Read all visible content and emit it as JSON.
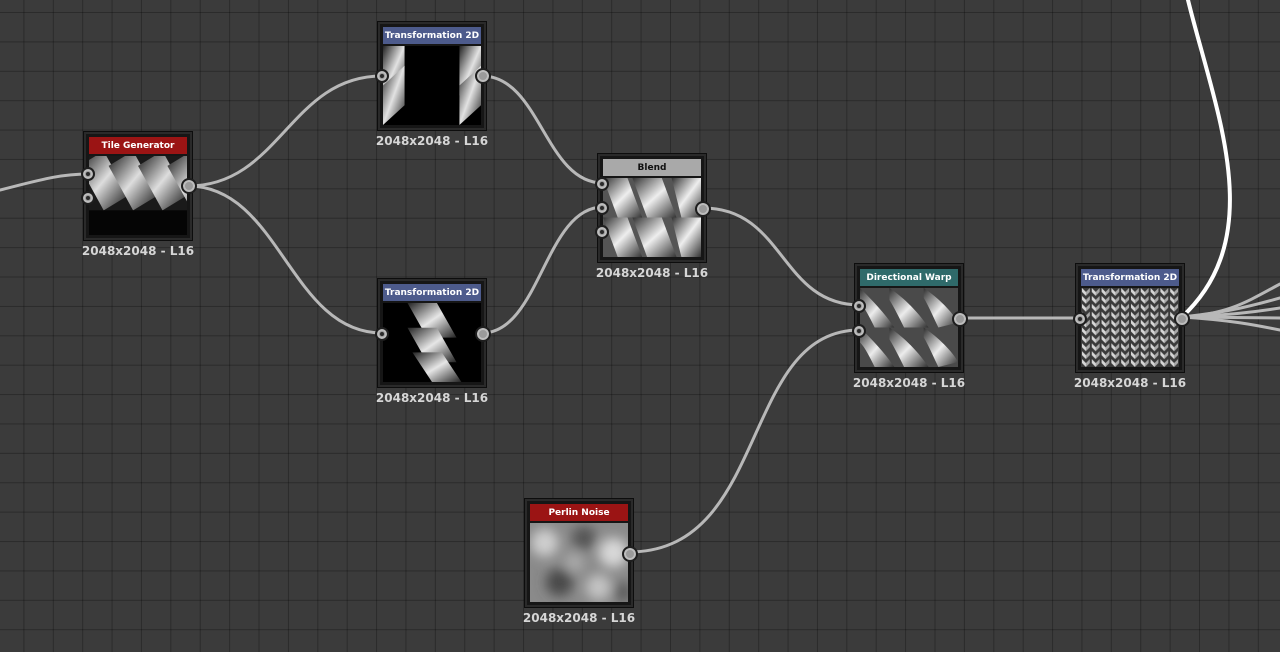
{
  "colors": {
    "canvas": "#3b3b3b",
    "wire": "#b8b8b8",
    "wire_highlight": "#ffffff",
    "header_generator": "#9b1414",
    "header_transform": "#4d5b8c",
    "header_blend": "#a9a9a9",
    "header_warp": "#2f6a6a"
  },
  "nodes": {
    "tile_generator": {
      "title": "Tile Generator",
      "resolution": "2048x2048 - L16"
    },
    "transform_top": {
      "title": "Transformation 2D",
      "resolution": "2048x2048 - L16"
    },
    "transform_bottom": {
      "title": "Transformation 2D",
      "resolution": "2048x2048 - L16"
    },
    "blend": {
      "title": "Blend",
      "resolution": "2048x2048 - L16"
    },
    "perlin_noise": {
      "title": "Perlin Noise",
      "resolution": "2048x2048 - L16"
    },
    "directional_warp": {
      "title": "Directional Warp",
      "resolution": "2048x2048 - L16"
    },
    "transform_final": {
      "title": "Transformation 2D",
      "resolution": "2048x2048 - L16"
    }
  }
}
